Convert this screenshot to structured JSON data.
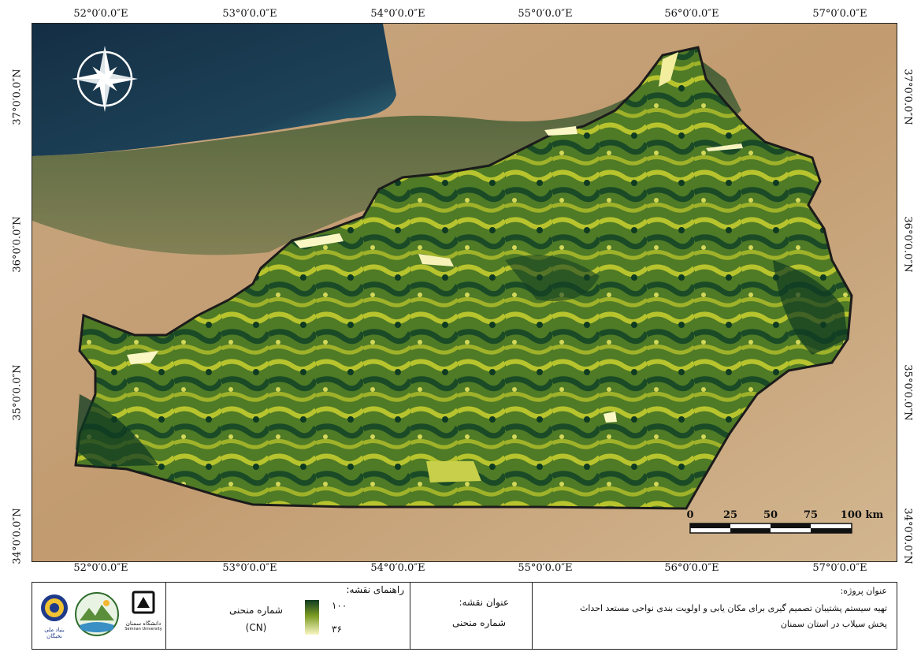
{
  "map": {
    "lon_labels": [
      "52°0′0.0″E",
      "53°0′0.0″E",
      "54°0′0.0″E",
      "55°0′0.0″E",
      "56°0′0.0″E",
      "57°0′0.0″E"
    ],
    "lat_labels": [
      "37°0′0.0″N",
      "36°0′0.0″N",
      "35°0′0.0″N",
      "34°0′0.0″N"
    ],
    "colors": {
      "sea": "#1c3a4f",
      "desert": "#c7a37a",
      "mountain": "#5a6a3c",
      "boundary": "#1b1b1b",
      "cn_high": "#0f3b22",
      "cn_low": "#fbf7c4",
      "cn_mid": "#aab82a"
    },
    "north_arrow_icon": "compass-rose-icon",
    "scale_bar": {
      "ticks": [
        "0",
        "25",
        "50",
        "75",
        "100 km"
      ]
    }
  },
  "project": {
    "label": "عنوان پروژه:",
    "lines": [
      "تهیه سیستم پشتیبان تصمیم گیری برای مکان یابی و اولویت بندی نواحی مستعد احداث",
      "پخش سیلاب در استان سمنان"
    ]
  },
  "map_title": {
    "label": "عنوان نقشه:",
    "value": "شماره منحنی"
  },
  "legend": {
    "label": "راهنمای نقشه:",
    "item_name": "شماره منحنی",
    "item_unit": "(CN)",
    "high_value": "۱۰۰",
    "low_value": "۳۶"
  },
  "logos": {
    "elites_name": "بنیاد ملی نخبگان",
    "semnan_name": "دانشگاه سمنان",
    "semnan_en": "Semnan University"
  }
}
